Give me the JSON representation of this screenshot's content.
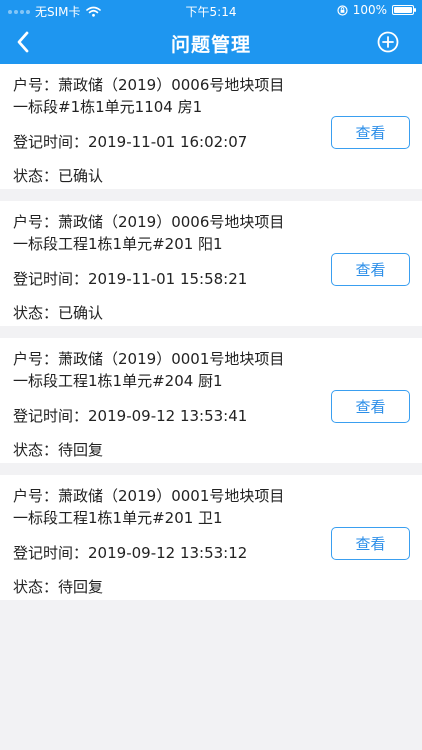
{
  "status_bar": {
    "carrier": "无SIM卡",
    "time": "下午5:14",
    "battery": "100%",
    "battery_level": 1.0
  },
  "nav": {
    "title": "问题管理",
    "back_icon": "chevron-left-icon",
    "add_icon": "plus-circle-icon"
  },
  "colors": {
    "header": "#1e96f0",
    "button_border": "#3a9ff0",
    "background": "#f2f2f4"
  },
  "issues": [
    {
      "house_label": "户号：",
      "house_line1": "萧政储（2019）0006号地块项目",
      "house_line2": "一标段#1栋1单元1104 房1",
      "time_label": "登记时间：",
      "time": "2019-11-01 16:02:07",
      "status_label": "状态：",
      "status": "已确认",
      "button": "查看"
    },
    {
      "house_label": "户号：",
      "house_line1": "萧政储（2019）0006号地块项目",
      "house_line2": "一标段工程1栋1单元#201 阳1",
      "time_label": "登记时间：",
      "time": "2019-11-01 15:58:21",
      "status_label": "状态：",
      "status": "已确认",
      "button": "查看"
    },
    {
      "house_label": "户号：",
      "house_line1": "萧政储（2019）0001号地块项目",
      "house_line2": "一标段工程1栋1单元#204 厨1",
      "time_label": "登记时间：",
      "time": "2019-09-12 13:53:41",
      "status_label": "状态：",
      "status": "待回复",
      "button": "查看"
    },
    {
      "house_label": "户号：",
      "house_line1": "萧政储（2019）0001号地块项目",
      "house_line2": "一标段工程1栋1单元#201 卫1",
      "time_label": "登记时间：",
      "time": "2019-09-12 13:53:12",
      "status_label": "状态：",
      "status": "待回复",
      "button": "查看"
    }
  ]
}
